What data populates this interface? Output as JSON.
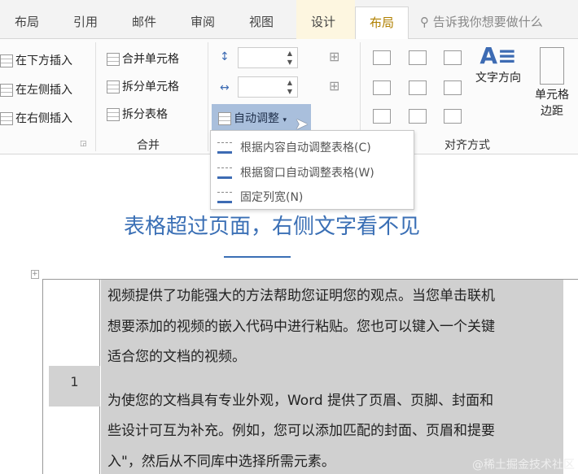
{
  "tabs": [
    "布局",
    "引用",
    "邮件",
    "审阅",
    "视图",
    "设计",
    "布局"
  ],
  "search_placeholder": "告诉我你想要做什么",
  "rows_cols": {
    "insert_below": "在下方插入",
    "insert_left": "在左侧插入",
    "insert_right": "在右侧插入"
  },
  "merge": {
    "merge_cells": "合并单元格",
    "split_cells": "拆分单元格",
    "split_table": "拆分表格",
    "group_label": "合并"
  },
  "cell_size": {
    "height_value": "",
    "width_value": "",
    "autofit": "自动调整"
  },
  "autofit_menu": [
    "根据内容自动调整表格(C)",
    "根据窗口自动调整表格(W)",
    "固定列宽(N)"
  ],
  "alignment": {
    "text_direction": "文字方向",
    "cell_margins_1": "单元格",
    "cell_margins_2": "边距",
    "group_label": "对齐方式"
  },
  "document": {
    "title": "表格超过页面，右侧文字看不见",
    "row_number": "1",
    "paragraphs": [
      "视频提供了功能强大的方法帮助您证明您的观点。当您单击联机",
      "想要添加的视频的嵌入代码中进行粘贴。您也可以键入一个关键",
      "适合您的文档的视频。",
      "为使您的文档具有专业外观，Word 提供了页眉、页脚、封面和",
      "些设计可互为补充。例如，您可以添加匹配的封面、页眉和提要",
      "入\"，然后从不同库中选择所需元素。"
    ]
  },
  "watermark": "@稀土掘金技术社区"
}
